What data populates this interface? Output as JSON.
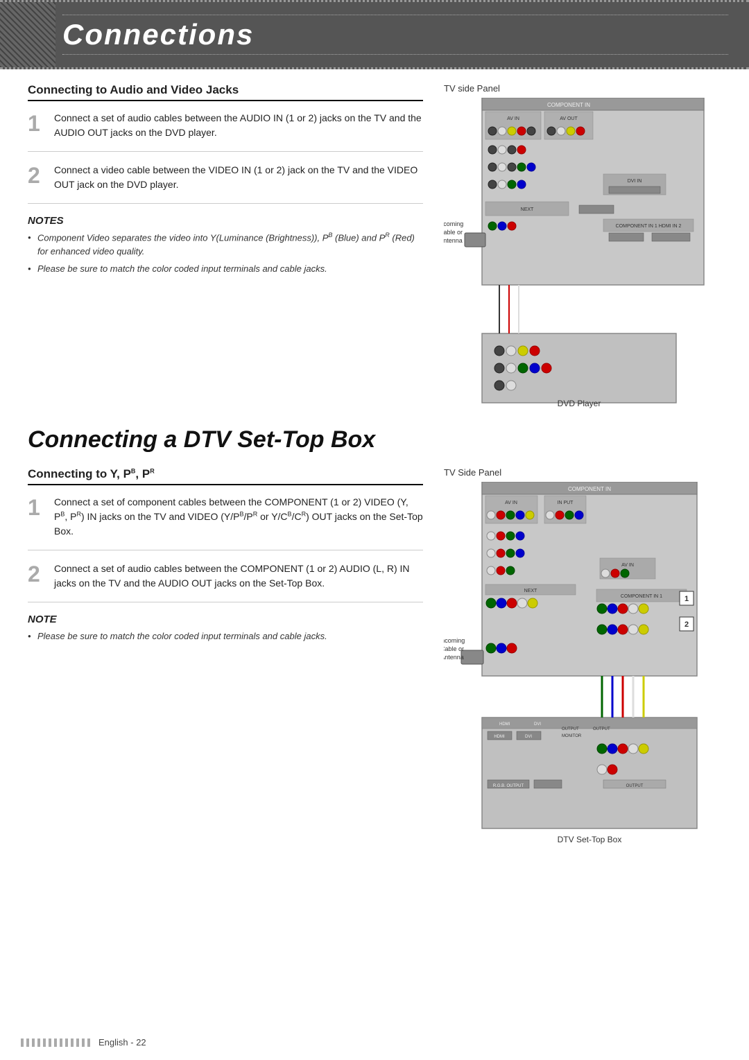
{
  "header": {
    "title": "Connections"
  },
  "section1": {
    "title": "Connecting to Audio and Video Jacks",
    "step1": {
      "num": "1",
      "text": "Connect a set of audio cables between the AUDIO IN (1 or 2) jacks on the TV and the AUDIO OUT jacks on the DVD player."
    },
    "step2": {
      "num": "2",
      "text": "Connect a video cable between the VIDEO IN (1 or 2) jack on the TV and the VIDEO OUT jack on the DVD player."
    },
    "notes_title": "NOTES",
    "notes": [
      "Component Video separates the video into Y(Luminance (Brightness)), PB (Blue) and PR (Red) for enhanced video quality.",
      "Please be sure to match the color coded input terminals and cable jacks."
    ],
    "tv_side_panel_label": "TV side Panel",
    "incoming_label": "Incoming\nCable or\nAntenna",
    "dvd_label": "DVD Player"
  },
  "section2": {
    "big_title": "Connecting a DTV Set-Top Box",
    "subsection_title": "Connecting to Y, PB, PR",
    "step1": {
      "num": "1",
      "text": "Connect a set of component cables between the COMPONENT (1 or 2) VIDEO (Y, PB, PR) IN jacks on the TV and VIDEO (Y/PB/PR or Y/CB/CR) OUT jacks on the Set-Top Box."
    },
    "step2": {
      "num": "2",
      "text": "Connect a set of audio cables between the COMPONENT (1 or 2) AUDIO (L, R) IN jacks on the TV and the AUDIO OUT jacks on the Set-Top Box."
    },
    "note_title": "NOTE",
    "notes": [
      "Please be sure to match the color coded input terminals and cable jacks."
    ],
    "tv_side_panel_label": "TV Side Panel",
    "incoming_label": "Incoming\nCable or\nAntenna",
    "dtv_label": "DTV Set-Top Box",
    "label1": "1",
    "label2": "2"
  },
  "footer": {
    "text": "English - 22"
  }
}
